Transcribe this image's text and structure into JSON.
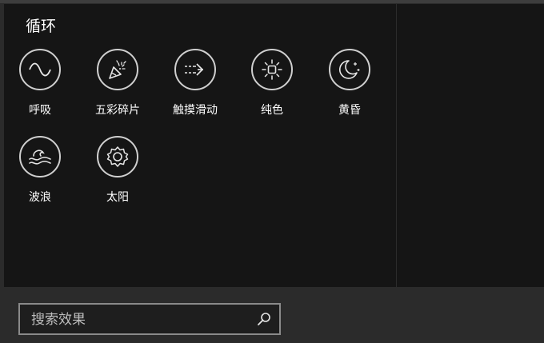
{
  "section": {
    "title": "循环"
  },
  "effects": [
    {
      "label": "呼吸",
      "icon": "sine-wave-icon"
    },
    {
      "label": "五彩碎片",
      "icon": "party-popper-icon"
    },
    {
      "label": "触摸滑动",
      "icon": "swipe-arrow-icon"
    },
    {
      "label": "纯色",
      "icon": "brightness-icon"
    },
    {
      "label": "黄昏",
      "icon": "moon-stars-icon"
    },
    {
      "label": "波浪",
      "icon": "wave-icon"
    },
    {
      "label": "太阳",
      "icon": "gear-sun-icon"
    }
  ],
  "search": {
    "placeholder": "搜索效果",
    "value": ""
  }
}
